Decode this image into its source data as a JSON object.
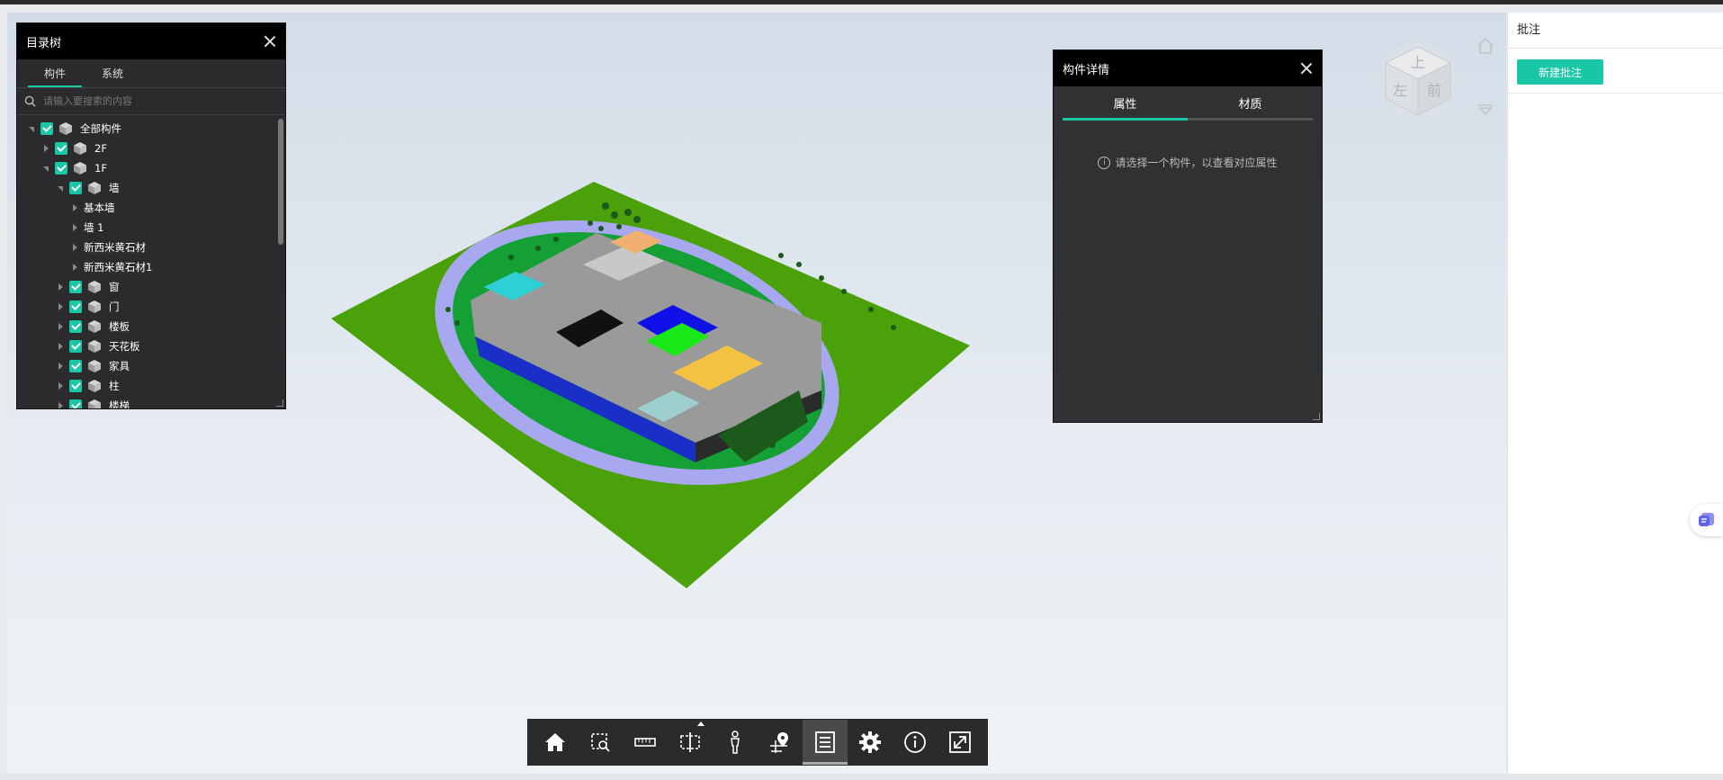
{
  "tree": {
    "title": "目录树",
    "tabs": [
      {
        "label": "构件",
        "active": true
      },
      {
        "label": "系统",
        "active": false
      }
    ],
    "search_placeholder": "请输入要搜索的内容",
    "items": [
      {
        "label": "全部构件",
        "level": 0,
        "expanded": true,
        "checkbox": true,
        "icon": "cube-icon"
      },
      {
        "label": "2F",
        "level": 1,
        "expanded": false,
        "checkbox": true,
        "icon": "cube-icon"
      },
      {
        "label": "1F",
        "level": 1,
        "expanded": true,
        "checkbox": true,
        "icon": "cube-icon"
      },
      {
        "label": "墙",
        "level": 2,
        "expanded": true,
        "checkbox": true,
        "icon": "cube-icon"
      },
      {
        "label": "基本墙",
        "level": 3,
        "expanded": false,
        "checkbox": false,
        "icon": null
      },
      {
        "label": "墙 1",
        "level": 3,
        "expanded": false,
        "checkbox": false,
        "icon": null
      },
      {
        "label": "新西米黄石材",
        "level": 3,
        "expanded": false,
        "checkbox": false,
        "icon": null
      },
      {
        "label": "新西米黄石材1",
        "level": 3,
        "expanded": false,
        "checkbox": false,
        "icon": null
      },
      {
        "label": "窗",
        "level": 2,
        "expanded": false,
        "checkbox": true,
        "icon": "cube-icon"
      },
      {
        "label": "门",
        "level": 2,
        "expanded": false,
        "checkbox": true,
        "icon": "cube-icon"
      },
      {
        "label": "楼板",
        "level": 2,
        "expanded": false,
        "checkbox": true,
        "icon": "cube-icon"
      },
      {
        "label": "天花板",
        "level": 2,
        "expanded": false,
        "checkbox": true,
        "icon": "cube-icon"
      },
      {
        "label": "家具",
        "level": 2,
        "expanded": false,
        "checkbox": true,
        "icon": "cube-icon"
      },
      {
        "label": "柱",
        "level": 2,
        "expanded": false,
        "checkbox": true,
        "icon": "cube-icon"
      },
      {
        "label": "楼梯",
        "level": 2,
        "expanded": false,
        "checkbox": true,
        "icon": "cube-icon"
      }
    ]
  },
  "detail": {
    "title": "构件详情",
    "tabs": [
      {
        "label": "属性",
        "active": true
      },
      {
        "label": "材质",
        "active": false
      }
    ],
    "hint": "请选择一个构件，以查看对应属性"
  },
  "viewcube": {
    "faces": {
      "top": "上",
      "left": "左",
      "front": "前"
    }
  },
  "toolbar": {
    "tools": [
      {
        "name": "home-tool",
        "icon": "home-icon",
        "active": false
      },
      {
        "name": "zoom-box-tool",
        "icon": "zoom-box-icon",
        "active": false
      },
      {
        "name": "measure-tool",
        "icon": "ruler-icon",
        "active": false
      },
      {
        "name": "section-tool",
        "icon": "section-box-icon",
        "active": false,
        "has_menu": true
      },
      {
        "name": "walk-tool",
        "icon": "person-icon",
        "active": false
      },
      {
        "name": "locate-tool",
        "icon": "location-pin-icon",
        "active": false
      },
      {
        "name": "tree-tool",
        "icon": "list-icon",
        "active": true
      },
      {
        "name": "settings-tool",
        "icon": "gear-icon",
        "active": false
      },
      {
        "name": "info-tool",
        "icon": "info-icon",
        "active": false
      },
      {
        "name": "fullscreen-tool",
        "icon": "fullscreen-icon",
        "active": false
      }
    ]
  },
  "annotation": {
    "title": "批注",
    "new_button": "新建批注"
  },
  "colors": {
    "accent": "#19c6a6",
    "panel_bg": "#2b2b2d",
    "panel_head": "#000000",
    "toolbar_bg": "#2b2b2b"
  }
}
